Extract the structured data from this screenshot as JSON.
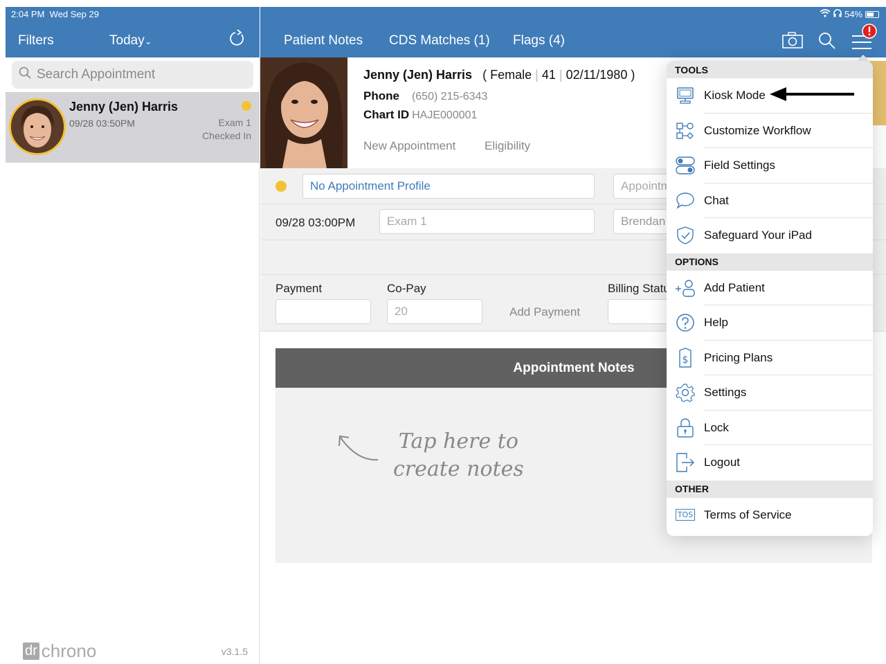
{
  "status_bar": {
    "time": "2:04 PM",
    "date": "Wed Sep 29",
    "battery": "54%"
  },
  "sidebar_header": {
    "filters_label": "Filters",
    "date_filter": "Today"
  },
  "header_tabs": [
    {
      "label": "Patient Notes"
    },
    {
      "label": "CDS Matches (1)"
    },
    {
      "label": "Flags (4)"
    }
  ],
  "search": {
    "placeholder": "Search Appointment"
  },
  "appointment_list": [
    {
      "name": "Jenny (Jen) Harris",
      "time": "09/28 03:50PM",
      "room": "Exam 1",
      "status": "Checked In"
    }
  ],
  "patient": {
    "name": "Jenny (Jen) Harris",
    "gender": "Female",
    "age": "41",
    "dob": "02/11/1980",
    "phone_label": "Phone",
    "phone": "(650) 215-6343",
    "chart_id_label": "Chart ID",
    "chart_id": "HAJE000001",
    "new_appointment_link": "New Appointment",
    "eligibility_link": "Eligibility"
  },
  "appointment": {
    "profile": "No Appointment Profile",
    "profile_placeholder_right": "Appointment",
    "datetime": "09/28 03:00PM",
    "room_value": "Exam 1",
    "provider_value": "Brendan"
  },
  "payment": {
    "payment_label": "Payment",
    "copay_label": "Co-Pay",
    "copay_value": "20",
    "add_payment_label": "Add Payment",
    "billing_status_label": "Billing Status"
  },
  "notes": {
    "title": "Appointment Notes",
    "hint_line1": "Tap here to",
    "hint_line2": "create notes"
  },
  "menu": {
    "sections": [
      {
        "title": "TOOLS",
        "items": [
          {
            "label": "Kiosk Mode",
            "icon": "monitor-icon"
          },
          {
            "label": "Customize Workflow",
            "icon": "workflow-icon"
          },
          {
            "label": "Field Settings",
            "icon": "toggles-icon"
          },
          {
            "label": "Chat",
            "icon": "chat-bubble-icon"
          },
          {
            "label": "Safeguard Your iPad",
            "icon": "shield-check-icon"
          }
        ]
      },
      {
        "title": "OPTIONS",
        "items": [
          {
            "label": "Add Patient",
            "icon": "add-person-icon"
          },
          {
            "label": "Help",
            "icon": "question-circle-icon"
          },
          {
            "label": "Pricing Plans",
            "icon": "price-tag-icon"
          },
          {
            "label": "Settings",
            "icon": "gear-icon"
          },
          {
            "label": "Lock",
            "icon": "padlock-icon"
          },
          {
            "label": "Logout",
            "icon": "logout-icon"
          }
        ]
      },
      {
        "title": "OTHER",
        "items": [
          {
            "label": "Terms of Service",
            "icon": "tos-icon"
          }
        ]
      }
    ],
    "tos_icon_text": "TOS"
  },
  "footer": {
    "logo_dr": "dr",
    "logo_chrono": "chrono",
    "version": "v3.1.5"
  },
  "colors": {
    "header_blue": "#3f7cb8",
    "status_yellow": "#f3c231",
    "alert_red": "#e02020"
  }
}
